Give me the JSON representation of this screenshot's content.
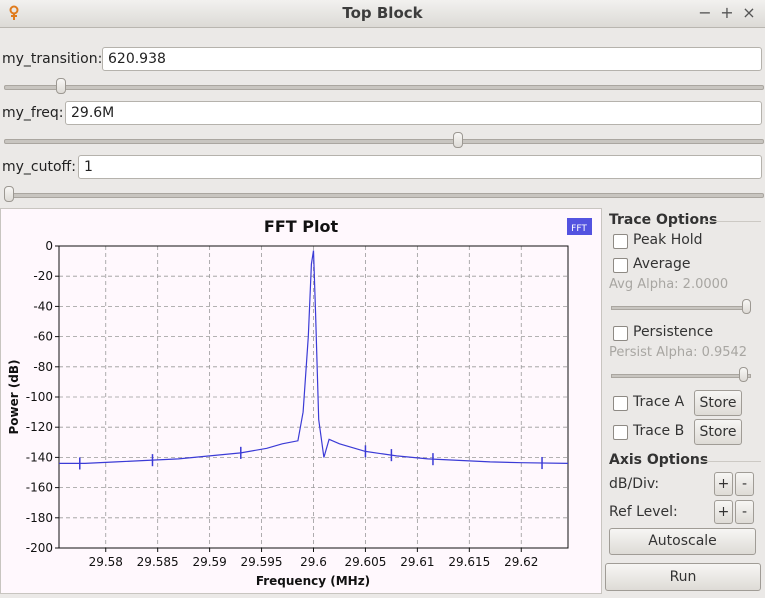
{
  "window": {
    "title": "Top Block",
    "buttons": {
      "minimize": "−",
      "maximize": "+",
      "close": "×"
    }
  },
  "controls": [
    {
      "label": "my_transition:",
      "value": "620.938",
      "slider_fraction": 0.07
    },
    {
      "label": "my_freq:",
      "value": "29.6M",
      "slider_fraction": 0.6
    },
    {
      "label": "my_cutoff:",
      "value": "1",
      "slider_fraction": 0.0
    }
  ],
  "plot": {
    "legend": "FFT"
  },
  "chart_data": {
    "type": "line",
    "title": "FFT Plot",
    "xlabel": "Frequency (MHz)",
    "ylabel": "Power (dB)",
    "xlim": [
      29.5755,
      29.6245
    ],
    "ylim": [
      -200,
      0
    ],
    "xticks": [
      "29.58",
      "29.585",
      "29.59",
      "29.595",
      "29.6",
      "29.605",
      "29.61",
      "29.615",
      "29.62"
    ],
    "yticks": [
      "0",
      "-20",
      "-40",
      "-60",
      "-80",
      "-100",
      "-120",
      "-140",
      "-160",
      "-180",
      "-200"
    ],
    "grid": true,
    "series": [
      {
        "name": "FFT",
        "color": "#3b3bd6",
        "x": [
          29.5755,
          29.578,
          29.581,
          29.584,
          29.587,
          29.59,
          29.593,
          29.5955,
          29.597,
          29.5985,
          29.599,
          29.5995,
          29.5998,
          29.6,
          29.6002,
          29.6005,
          29.601,
          29.6015,
          29.6025,
          29.605,
          29.608,
          29.611,
          29.614,
          29.617,
          29.62,
          29.6245
        ],
        "y": [
          -144,
          -144,
          -143,
          -142,
          -141,
          -139,
          -137,
          -134,
          -131,
          -129,
          -110,
          -60,
          -12,
          -3,
          -45,
          -115,
          -140,
          -128,
          -131,
          -136,
          -139,
          -141,
          -142,
          -143,
          -143.5,
          -144
        ]
      }
    ]
  },
  "trace_options": {
    "heading": "Trace Options",
    "peak_hold": "Peak Hold",
    "average": "Average",
    "avg_alpha": "Avg Alpha: 2.0000",
    "persistence": "Persistence",
    "persist_alpha": "Persist Alpha: 0.9542",
    "trace_a": "Trace A",
    "trace_b": "Trace B",
    "store": "Store"
  },
  "axis_options": {
    "heading": "Axis Options",
    "db_div": "dB/Div:",
    "ref_level": "Ref Level:",
    "plus": "+",
    "minus": "-",
    "autoscale": "Autoscale"
  },
  "run_label": "Run"
}
